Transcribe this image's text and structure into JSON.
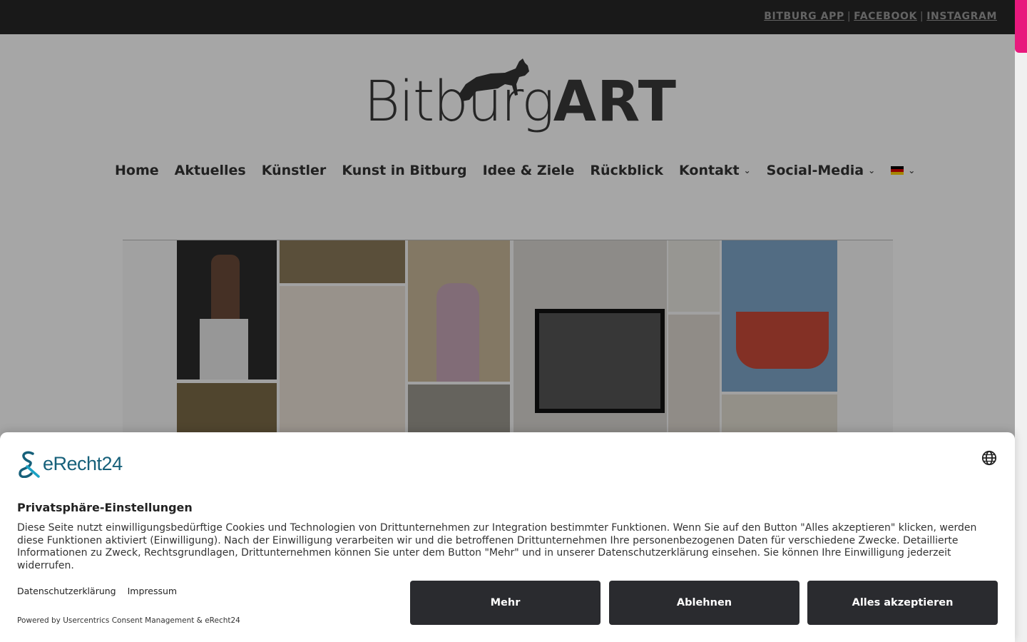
{
  "topbar": {
    "links": [
      "BITBURG APP",
      "FACEBOOK",
      "INSTAGRAM"
    ],
    "separator": "|"
  },
  "logo": {
    "part1": "Bitburg",
    "part2": "ART"
  },
  "nav": {
    "items": [
      {
        "label": "Home"
      },
      {
        "label": "Aktuelles"
      },
      {
        "label": "Künstler"
      },
      {
        "label": "Kunst in Bitburg"
      },
      {
        "label": "Idee & Ziele"
      },
      {
        "label": "Rückblick"
      },
      {
        "label": "Kontakt"
      },
      {
        "label": "Social-Media"
      }
    ],
    "language_icon": "german-flag-icon"
  },
  "consent": {
    "brand": "eRecht24",
    "title": "Privatsphäre-Einstellungen",
    "text": "Diese Seite nutzt einwilligungsbedürftige Cookies und Technologien von Drittunternehmen zur Integration bestimmter Funktionen. Wenn Sie auf den Button \"Alles akzeptieren\" klicken, werden diese Funktionen aktiviert (Einwilligung). Nach der Einwilligung verarbeiten wir und die betroffenen Drittunternehmen Ihre personenbezogenen Daten für verschiedene Zwecke. Detaillierte Informationen zu Zweck, Rechtsgrundlagen, Drittunternehmen können Sie unter dem Button \"Mehr\" und in unserer Datenschutzerklärung einsehen. Sie können Ihre Einwilligung jederzeit widerrufen.",
    "links": [
      "Datenschutzerklärung",
      "Impressum"
    ],
    "powered": "Powered by Usercentrics Consent Management & eRecht24",
    "buttons": {
      "more": "Mehr",
      "decline": "Ablehnen",
      "accept": "Alles akzeptieren"
    }
  },
  "colors": {
    "topbar": "#272727",
    "accent": "#e8197d",
    "brand": "#16607a",
    "button": "#2a2b2f"
  }
}
